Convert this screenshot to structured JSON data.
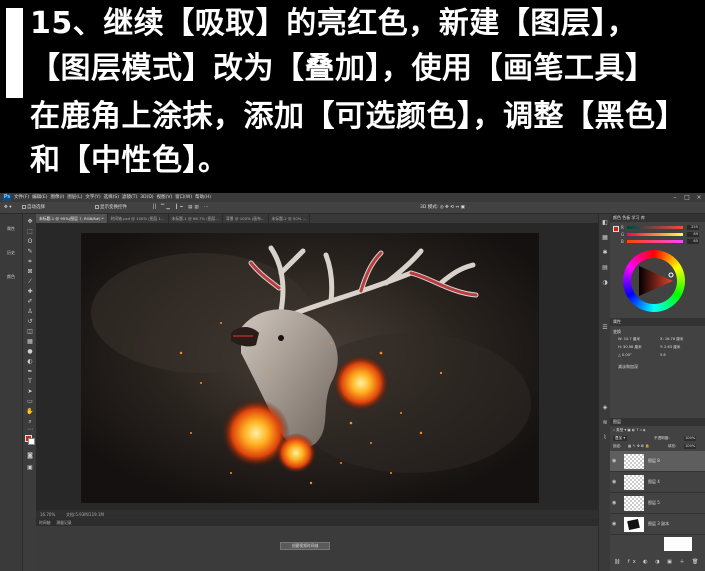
{
  "tutorial": {
    "line1": "15、继续【吸取】的亮红色，新建【图层】，",
    "line2": "【图层模式】改为【叠加】，使用【画笔工具】",
    "line3": "在鹿角上涂抹，添加【可选颜色】，调整【黑色】",
    "line4": "和【中性色】。"
  },
  "photoshop": {
    "menus": [
      "文件(F)",
      "编辑(E)",
      "图像(I)",
      "图层(L)",
      "文字(Y)",
      "选择(S)",
      "滤镜(T)",
      "3D(D)",
      "视图(V)",
      "窗口(W)",
      "帮助(H)"
    ],
    "options": {
      "sample": "自动选择",
      "show_transform": "显示变换控件"
    },
    "tabs": [
      {
        "label": "未标题-1 @ 95%(图层 7, RGB/8#) *",
        "active": true
      },
      {
        "label": "时间轴.psd @ 100% (图层 1...",
        "active": false
      },
      {
        "label": "未标题-1 @ 66.7% (图层...",
        "active": false
      },
      {
        "label": "背景 @ 100% (画布...",
        "active": false
      },
      {
        "label": "未标题-2 @ 50% ...",
        "active": false
      }
    ],
    "status": {
      "zoom": "16.70%",
      "doc": "文档:5.93M/119.1M"
    },
    "timeline": {
      "tabs": [
        "时间轴",
        "测量记录"
      ],
      "create_button": "创建视频时间轴"
    },
    "leftdock": [
      "属性",
      "历史",
      "颜色"
    ],
    "color_panel": {
      "sliders": [
        {
          "label": "R",
          "value": "255"
        },
        {
          "label": "G",
          "value": "69"
        },
        {
          "label": "B",
          "value": "65"
        }
      ]
    },
    "properties_panel": {
      "title": "属性",
      "subtitle": "变换",
      "fields": [
        "W: 10.7 厘米",
        "X: 16.76 厘米",
        "H: 30.98 厘米",
        "Y: 2.63 厘米",
        "△ 0.00°",
        "5.6"
      ],
      "section": "减淡和加深"
    },
    "layers_panel": {
      "title": "图层",
      "filter_label": "类型",
      "blend_mode": "叠加",
      "opacity_label": "不透明度:",
      "opacity": "100%",
      "lock_label": "锁定:",
      "fill_label": "填充:",
      "fill": "100%",
      "layers": [
        {
          "name": "图层 8",
          "selected": true
        },
        {
          "name": "图层 4",
          "selected": false
        },
        {
          "name": "图层 5",
          "selected": false
        },
        {
          "name": "图层 3 副本",
          "selected": false
        }
      ]
    },
    "colors": {
      "foreground": "#c8281a",
      "background": "#ffffff"
    }
  }
}
